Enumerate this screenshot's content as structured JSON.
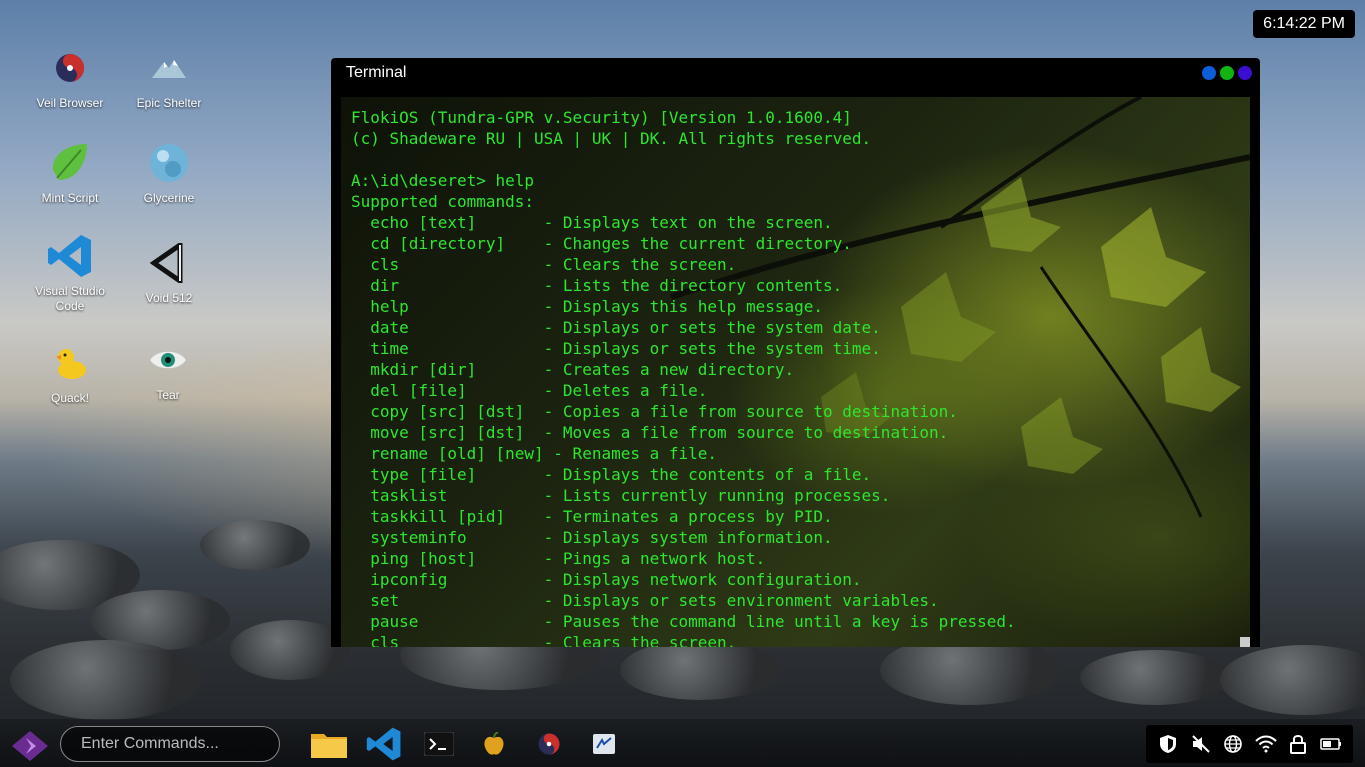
{
  "clock": {
    "time": "6:14:22 PM"
  },
  "desktop_icons": [
    {
      "label": "Veil Browser",
      "icon": "veil-browser-icon"
    },
    {
      "label": "Epic Shelter",
      "icon": "mountain-icon"
    },
    {
      "label": "Mint Script",
      "icon": "mint-leaf-icon"
    },
    {
      "label": "Glycerine",
      "icon": "glycerine-orb-icon"
    },
    {
      "label": "Visual Studio Code",
      "icon": "vscode-icon"
    },
    {
      "label": "Void 512",
      "icon": "void-512-icon"
    },
    {
      "label": "Quack!",
      "icon": "duck-icon"
    },
    {
      "label": "Tear",
      "icon": "eye-icon"
    }
  ],
  "window": {
    "title": "Terminal",
    "controls": [
      {
        "name": "minimize",
        "color": "#0b5ed7"
      },
      {
        "name": "maximize",
        "color": "#11b511"
      },
      {
        "name": "close",
        "color": "#3b0fd1"
      }
    ]
  },
  "terminal": {
    "text": "FlokiOS (Tundra-GPR v.Security) [Version 1.0.1600.4]\n(c) Shadeware RU | USA | UK | DK. All rights reserved.\n\nA:\\id\\deseret> help\nSupported commands:\n  echo [text]       - Displays text on the screen.\n  cd [directory]    - Changes the current directory.\n  cls               - Clears the screen.\n  dir               - Lists the directory contents.\n  help              - Displays this help message.\n  date              - Displays or sets the system date.\n  time              - Displays or sets the system time.\n  mkdir [dir]       - Creates a new directory.\n  del [file]        - Deletes a file.\n  copy [src] [dst]  - Copies a file from source to destination.\n  move [src] [dst]  - Moves a file from source to destination.\n  rename [old] [new] - Renames a file.\n  type [file]       - Displays the contents of a file.\n  tasklist          - Lists currently running processes.\n  taskkill [pid]    - Terminates a process by PID.\n  systeminfo        - Displays system information.\n  ping [host]       - Pings a network host.\n  ipconfig          - Displays network configuration.\n  set               - Displays or sets environment variables.\n  pause             - Pauses the command line until a key is pressed.\n  cls               - Clears the screen.",
    "text_color": "#2ee62e"
  },
  "taskbar": {
    "command_placeholder": "Enter Commands...",
    "apps": [
      {
        "name": "file-explorer",
        "icon": "folder-icon"
      },
      {
        "name": "visual-studio-code",
        "icon": "vscode-icon"
      },
      {
        "name": "terminal",
        "icon": "terminal-icon"
      },
      {
        "name": "fruit-app",
        "icon": "apple-icon"
      },
      {
        "name": "veil-browser",
        "icon": "veil-browser-icon"
      },
      {
        "name": "cv-app",
        "icon": "cv-icon"
      }
    ],
    "tray": [
      {
        "name": "security",
        "icon": "shield-icon"
      },
      {
        "name": "volume",
        "icon": "muted-speaker-icon"
      },
      {
        "name": "network",
        "icon": "globe-icon"
      },
      {
        "name": "wifi",
        "icon": "wifi-icon"
      },
      {
        "name": "lock",
        "icon": "lock-icon"
      },
      {
        "name": "battery",
        "icon": "battery-icon"
      }
    ]
  }
}
